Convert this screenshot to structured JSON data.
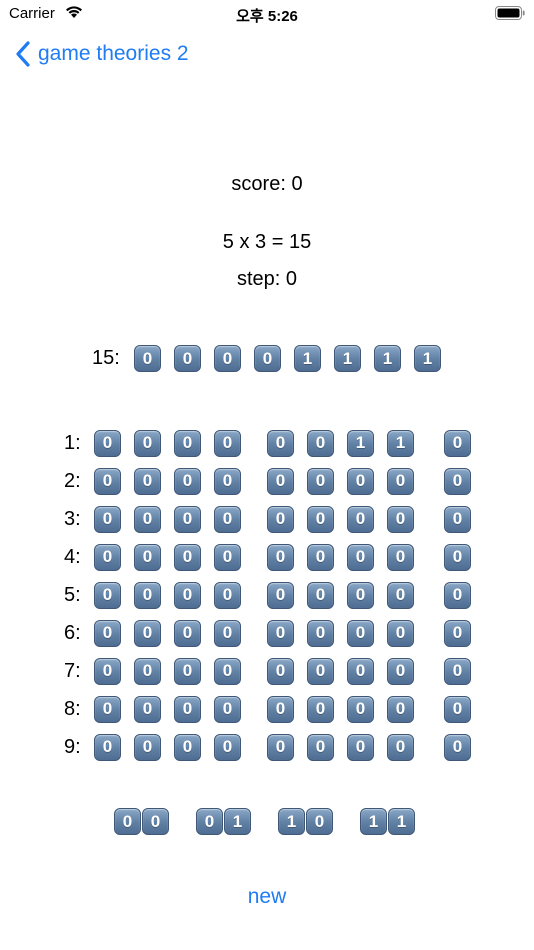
{
  "status_bar": {
    "carrier": "Carrier",
    "time": "오후 5:26"
  },
  "nav": {
    "back_label": "game theories 2"
  },
  "game": {
    "score": "score: 0",
    "equation": "5 x 3 = 15",
    "step": "step: 0",
    "target": {
      "label": "15:",
      "bits": [
        "0",
        "0",
        "0",
        "0",
        "1",
        "1",
        "1",
        "1"
      ]
    },
    "rows": [
      {
        "label": "1:",
        "left": [
          "0",
          "0",
          "0",
          "0"
        ],
        "right": [
          "0",
          "0",
          "1",
          "1"
        ],
        "result": "0"
      },
      {
        "label": "2:",
        "left": [
          "0",
          "0",
          "0",
          "0"
        ],
        "right": [
          "0",
          "0",
          "0",
          "0"
        ],
        "result": "0"
      },
      {
        "label": "3:",
        "left": [
          "0",
          "0",
          "0",
          "0"
        ],
        "right": [
          "0",
          "0",
          "0",
          "0"
        ],
        "result": "0"
      },
      {
        "label": "4:",
        "left": [
          "0",
          "0",
          "0",
          "0"
        ],
        "right": [
          "0",
          "0",
          "0",
          "0"
        ],
        "result": "0"
      },
      {
        "label": "5:",
        "left": [
          "0",
          "0",
          "0",
          "0"
        ],
        "right": [
          "0",
          "0",
          "0",
          "0"
        ],
        "result": "0"
      },
      {
        "label": "6:",
        "left": [
          "0",
          "0",
          "0",
          "0"
        ],
        "right": [
          "0",
          "0",
          "0",
          "0"
        ],
        "result": "0"
      },
      {
        "label": "7:",
        "left": [
          "0",
          "0",
          "0",
          "0"
        ],
        "right": [
          "0",
          "0",
          "0",
          "0"
        ],
        "result": "0"
      },
      {
        "label": "8:",
        "left": [
          "0",
          "0",
          "0",
          "0"
        ],
        "right": [
          "0",
          "0",
          "0",
          "0"
        ],
        "result": "0"
      },
      {
        "label": "9:",
        "left": [
          "0",
          "0",
          "0",
          "0"
        ],
        "right": [
          "0",
          "0",
          "0",
          "0"
        ],
        "result": "0"
      }
    ],
    "combos": [
      [
        "0",
        "0"
      ],
      [
        "0",
        "1"
      ],
      [
        "1",
        "0"
      ],
      [
        "1",
        "1"
      ]
    ],
    "new_label": "new"
  }
}
